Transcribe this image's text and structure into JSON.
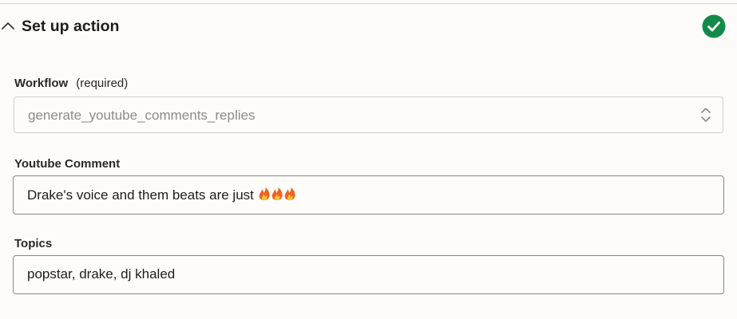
{
  "section": {
    "title": "Set up action",
    "status": "complete",
    "status_color": "#138a4a"
  },
  "workflow": {
    "label": "Workflow",
    "required_note": "(required)",
    "value": "generate_youtube_comments_replies"
  },
  "youtube_comment": {
    "label": "Youtube Comment",
    "value": "Drake's voice and them beats are just",
    "emoji": "fire-icon x3"
  },
  "topics": {
    "label": "Topics",
    "value": "popstar, drake, dj khaled"
  },
  "icons": {
    "collapse": "chevron-up-icon",
    "status": "check-circle-icon",
    "select": "up-down-chevrons-icon"
  }
}
